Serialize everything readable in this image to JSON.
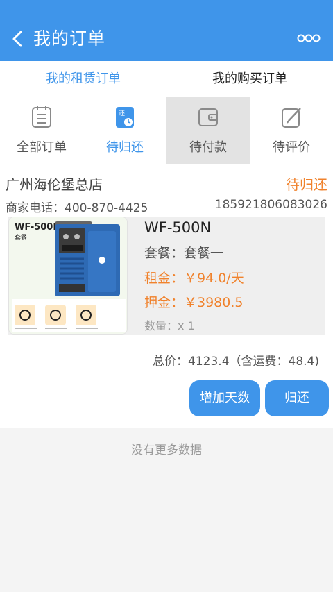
{
  "header": {
    "title": "我的订单",
    "back_icon": "chevron-left-icon",
    "more_icon": "more-dots-icon",
    "bg_color": "#3f95ea"
  },
  "top_tabs": [
    {
      "label": "我的租赁订单",
      "selected": true
    },
    {
      "label": "我的购买订单",
      "selected": false
    }
  ],
  "status_tabs": [
    {
      "label": "全部订单",
      "icon": "clipboard-list-icon",
      "selected": false
    },
    {
      "label": "待归还",
      "icon": "return-clock-icon",
      "icon_text": "还",
      "selected": true
    },
    {
      "label": "待付款",
      "icon": "wallet-icon",
      "selected": false
    },
    {
      "label": "待评价",
      "icon": "edit-icon",
      "selected": false
    }
  ],
  "order": {
    "shop_name": "广州海伦堡总店",
    "status": "待归还",
    "shop_phone": "商家电话：400-870-4425",
    "user_phone": "18592180608302 6",
    "product": {
      "name": "WF-500N",
      "thumb_model": "WF-500N",
      "thumb_pkg": "套餐一",
      "package": "套餐：套餐一",
      "rent": "租金：￥94.0/天",
      "deposit": "押金：￥3980.5",
      "quantity": "数量：x 1"
    },
    "total": "总价：4123.4（含运费：48.4)",
    "buttons": {
      "extend": "增加天数",
      "return": "归还"
    }
  },
  "footer": {
    "no_more": "没有更多数据"
  },
  "colors": {
    "accent": "#3f95ea",
    "orange": "#f0822c"
  }
}
